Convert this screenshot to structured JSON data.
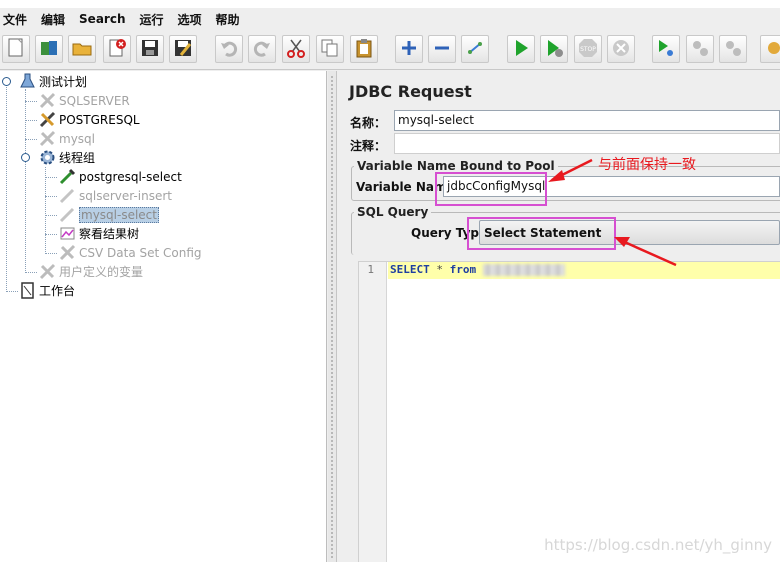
{
  "menu": [
    "文件",
    "编辑",
    "Search",
    "运行",
    "选项",
    "帮助"
  ],
  "toolbar": {
    "buttons": [
      "new-icon",
      "templates-icon",
      "open-icon",
      "close-icon",
      "save-icon",
      "save-as-icon",
      "undo-icon",
      "redo-icon",
      "cut-icon",
      "copy-icon",
      "paste-icon",
      "expand-icon",
      "collapse-icon",
      "toggle-icon",
      "start-icon",
      "start-no-pause-icon",
      "stop-icon",
      "shutdown-icon",
      "remote-start-icon",
      "remote-stop-icon",
      "remote-shutdown-icon",
      "clear-icon"
    ]
  },
  "tree": {
    "root": "测试计划",
    "sqlserver": "SQLSERVER",
    "postgresql": "POSTGRESQL",
    "mysql": "mysql",
    "thread_group": "线程组",
    "pg_select": "postgresql-select",
    "sqlserver_insert": "sqlserver-insert",
    "mysql_select": "mysql-select",
    "result_tree": "察看结果树",
    "csv_config": "CSV Data Set Config",
    "user_vars": "用户定义的变量",
    "workbench": "工作台"
  },
  "panel": {
    "title": "JDBC Request",
    "name_label": "名称：",
    "name_value": "mysql-select",
    "comment_label": "注释：",
    "comment_value": "",
    "pool_legend": "Variable Name Bound to Pool",
    "var_label": "Variable Name:",
    "var_value": "jdbcConfigMysql",
    "sql_legend": "SQL Query",
    "query_type_label": "Query Type:",
    "query_type_value": "Select Statement"
  },
  "editor": {
    "line_number": "1",
    "kw_select": "SELECT",
    "star": "*",
    "kw_from": "from"
  },
  "annotation": {
    "text": "与前面保持一致",
    "color": "#e8191f",
    "box_color": "#d64fd1"
  },
  "watermark": "https://blog.csdn.net/yh_ginny"
}
